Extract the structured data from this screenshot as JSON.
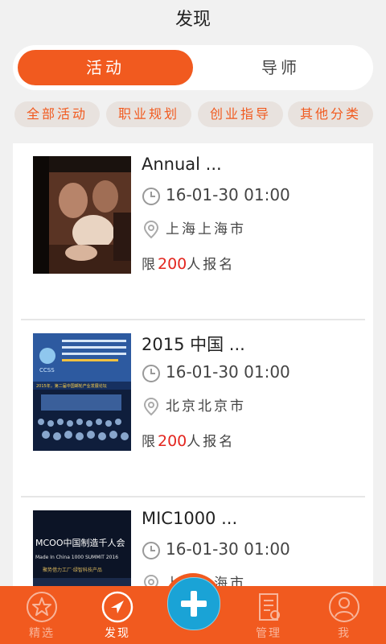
{
  "header": {
    "title": "发现"
  },
  "segment": {
    "tabs": [
      {
        "label": "活动"
      },
      {
        "label": "导师"
      }
    ]
  },
  "filters": [
    {
      "label": "全部活动"
    },
    {
      "label": "职业规划"
    },
    {
      "label": "创业指导"
    },
    {
      "label": "其他分类"
    }
  ],
  "events": [
    {
      "title": "Annual ...",
      "time": "16-01-30 01:00",
      "location": "上海上海市",
      "limit_prefix": "限",
      "limit_num": "200",
      "limit_suffix": "人报名"
    },
    {
      "title": "2015 中国 ...",
      "time": "16-01-30 01:00",
      "location": "北京北京市",
      "limit_prefix": "限",
      "limit_num": "200",
      "limit_suffix": "人报名"
    },
    {
      "title": "MIC1000 ...",
      "time": "16-01-30 01:00",
      "location": "上海上海市",
      "thumb_text_1": "MCOO中国制造千人会",
      "thumb_text_2": "Made In China 1000 SUMMIT 2016",
      "thumb_text_3": "聚势借力工厂·绿智科技产品"
    }
  ],
  "thumb2": {
    "logo_text": "CCSS",
    "banner_text": "2015年，第二届中国邮轮产业发展论坛"
  },
  "tabbar": {
    "items": [
      {
        "label": "精选"
      },
      {
        "label": "发现"
      },
      {
        "label": "管理"
      },
      {
        "label": "我"
      }
    ]
  },
  "colors": {
    "accent": "#f15a1f",
    "fab_blue": "#1aa3d6",
    "limit_red": "#e3261f"
  }
}
